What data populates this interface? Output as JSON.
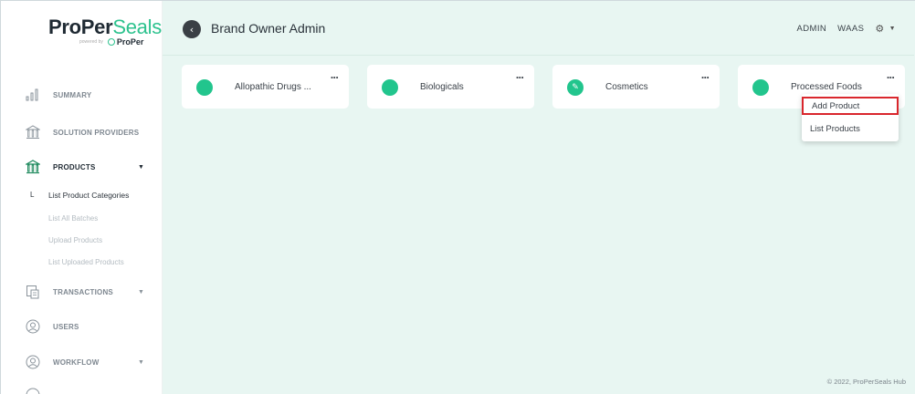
{
  "brand": {
    "name_part1": "ProPer",
    "name_part2": "Seals",
    "powered_small": "powered by",
    "sub_brand": "ProPer"
  },
  "header": {
    "title": "Brand Owner Admin",
    "user": "ADMIN",
    "org": "WAAS"
  },
  "sidebar": {
    "items": [
      {
        "label": "SUMMARY",
        "icon": "bar-chart-icon"
      },
      {
        "label": "SOLUTION PROVIDERS",
        "icon": "bank-icon"
      },
      {
        "label": "PRODUCTS",
        "icon": "bank-icon",
        "expanded": true
      },
      {
        "label": "TRANSACTIONS",
        "icon": "document-icon"
      },
      {
        "label": "USERS",
        "icon": "user-circle-icon"
      },
      {
        "label": "WORKFLOW",
        "icon": "user-circle-icon"
      }
    ],
    "products_marker": "L",
    "products_sub": [
      "List Product Categories",
      "List All Batches",
      "Upload Products",
      "List Uploaded Products"
    ]
  },
  "categories": [
    {
      "label": "Allopathic Drugs ...",
      "more": "..."
    },
    {
      "label": "Biologicals",
      "more": "..."
    },
    {
      "label": "Cosmetics",
      "more": "..."
    },
    {
      "label": "Processed Foods",
      "more": "..."
    }
  ],
  "dropdown": {
    "items": [
      "Add Product",
      "List Products"
    ],
    "highlighted": "Add Product"
  },
  "footer": "© 2022, ProPerSeals Hub",
  "colors": {
    "accent": "#22c58d",
    "background": "#e8f6f2",
    "highlight_border": "#d9262c"
  }
}
